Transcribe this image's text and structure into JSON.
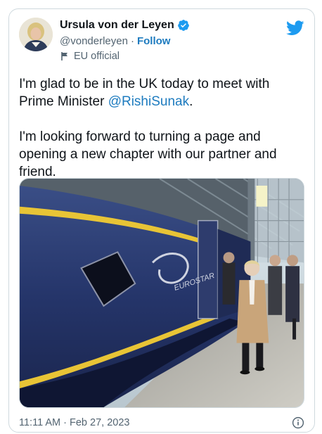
{
  "author": {
    "display_name": "Ursula von der Leyen",
    "handle": "@vonderleyen",
    "separator": "·",
    "follow_label": "Follow",
    "label": "EU official",
    "avatar_icon": "avatar",
    "verified_icon": "verified-badge-icon",
    "label_icon": "flag-icon"
  },
  "brand": {
    "icon": "twitter-bird-icon",
    "color": "#1d9bf0"
  },
  "tweet": {
    "line1_before": "I'm glad to be in the UK today to meet with Prime Minister ",
    "mention": "@RishiSunak",
    "line1_after": ".",
    "paragraph2": "I'm looking forward to turning a page and opening a new chapter with our partner and friend."
  },
  "media": {
    "train_text": "EUROSTAR"
  },
  "footer": {
    "timestamp": "11:11 AM · Feb 27, 2023",
    "info_icon": "info-icon"
  },
  "colors": {
    "link": "#1d7bbf",
    "text": "#0f1419",
    "muted": "#536471",
    "border": "#cfd9de"
  }
}
